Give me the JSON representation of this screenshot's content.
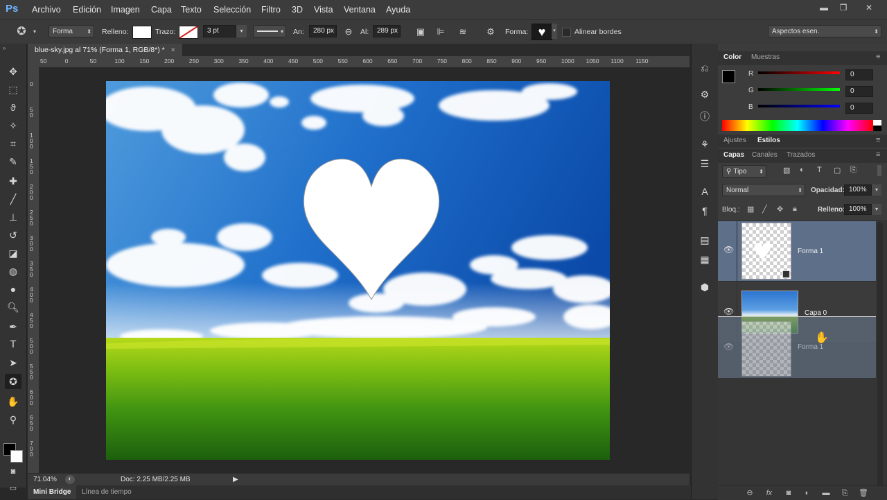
{
  "app": {
    "logo": "Ps"
  },
  "menu": [
    "Archivo",
    "Edición",
    "Imagen",
    "Capa",
    "Texto",
    "Selección",
    "Filtro",
    "3D",
    "Vista",
    "Ventana",
    "Ayuda"
  ],
  "window_buttons": {
    "minimize": "▬",
    "restore": "❐",
    "close": "✕"
  },
  "options": {
    "mode": "Forma",
    "fill_label": "Relleno:",
    "stroke_label": "Trazo:",
    "stroke_width": "3 pt",
    "width_label": "An:",
    "width_value": "280 px",
    "height_label": "Al:",
    "height_value": "289 px",
    "shape_label": "Forma:",
    "align_edges": "Alinear bordes",
    "workspace": "Aspectos esen."
  },
  "document": {
    "tab_title": "blue-sky.jpg al 71% (Forma 1, RGB/8*) *",
    "close": "×"
  },
  "ruler": {
    "h_ticks": [
      "50",
      "0",
      "50",
      "100",
      "150",
      "200",
      "250",
      "300",
      "350",
      "400",
      "450",
      "500",
      "550",
      "600",
      "650",
      "700",
      "750",
      "800",
      "850",
      "900",
      "950",
      "1000",
      "1050",
      "1100",
      "1150"
    ],
    "v_ticks": [
      "0",
      "5 0",
      "1 0 0",
      "1 5 0",
      "2 0 0",
      "2 5 0",
      "3 0 0",
      "3 5 0",
      "4 0 0",
      "4 5 0",
      "5 0 0",
      "5 5 0",
      "6 0 0",
      "6 5 0",
      "7 0 0"
    ]
  },
  "status": {
    "zoom": "71.04%",
    "doc": "Doc: 2.25 MB/2.25 MB"
  },
  "bottom_tabs": [
    "Mini Bridge",
    "Línea de tiempo"
  ],
  "color_panel": {
    "tabs": [
      "Color",
      "Muestras"
    ],
    "r_label": "R",
    "g_label": "G",
    "b_label": "B",
    "r": "0",
    "g": "0",
    "b": "0"
  },
  "styles_panel": {
    "tabs": [
      "Ajustes",
      "Estilos"
    ]
  },
  "layers_panel": {
    "tabs": [
      "Capas",
      "Canales",
      "Trazados"
    ],
    "filter": "Tipo",
    "blend_mode": "Normal",
    "opacity_label": "Opacidad:",
    "opacity": "100%",
    "lock_label": "Bloq.:",
    "fill_label": "Relleno:",
    "fill": "100%",
    "layers": [
      {
        "name": "Forma 1"
      },
      {
        "name": "Capa 0"
      },
      {
        "name": "Forma 1"
      }
    ]
  },
  "colors": {
    "accent_blue": "#6fb4ff",
    "selected_layer": "#5e6f8a"
  }
}
